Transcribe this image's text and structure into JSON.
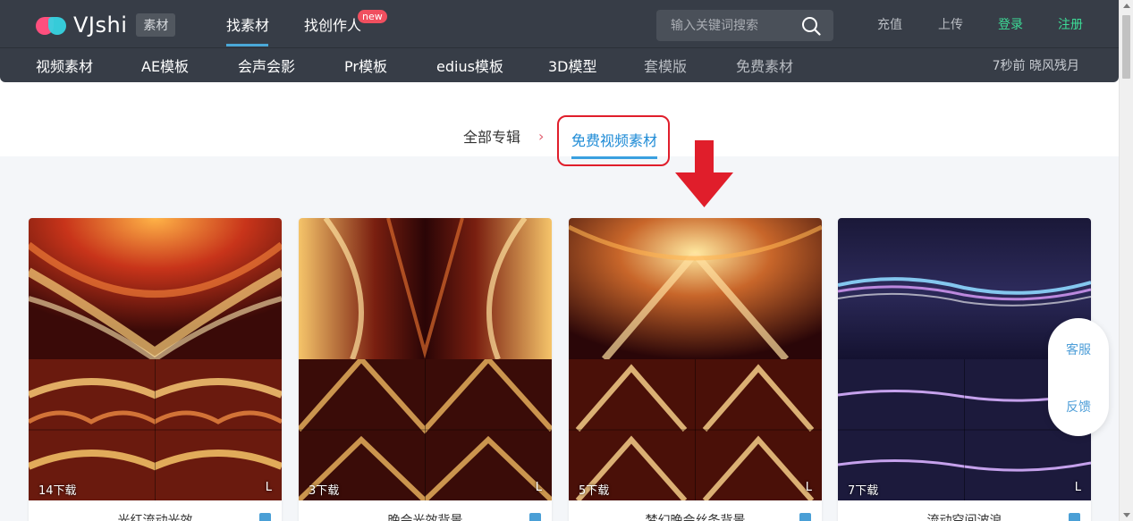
{
  "header": {
    "logo_text": "VJshi",
    "logo_tag": "素材",
    "nav": [
      {
        "label": "找素材"
      },
      {
        "label": "找创作人",
        "badge": "new"
      }
    ],
    "search": {
      "placeholder": "输入关键词搜索",
      "value": ""
    },
    "account": {
      "recharge": "充值",
      "upload": "上传",
      "login": "登录",
      "register": "注册"
    },
    "categories": [
      "视频素材",
      "AE模板",
      "会声会影",
      "Pr模板",
      "edius模板",
      "3D模型",
      "套模版",
      "免费素材"
    ],
    "recent_user": "7秒前 晓风残月"
  },
  "breadcrumb": {
    "all": "全部专辑",
    "separator": "›",
    "current": "免费视频素材"
  },
  "cards": [
    {
      "downloads": "14下载",
      "badge": "L",
      "title": "光红流动光效",
      "palette": "fire"
    },
    {
      "downloads": "3下载",
      "badge": "L",
      "title": "晚会光效背景",
      "palette": "ember"
    },
    {
      "downloads": "5下载",
      "badge": "L",
      "title": "梦幻晚会丝条背景",
      "palette": "gold"
    },
    {
      "downloads": "7下载",
      "badge": "L",
      "title": "流动空间波浪",
      "palette": "space"
    }
  ],
  "floating": {
    "service": "客服",
    "feedback": "反馈"
  },
  "colors": {
    "header_bg": "#373d47",
    "accent_blue": "#1e8bd6",
    "login_green": "#3ddc97",
    "highlight_red": "#e01e2b",
    "new_badge": "#f04f5f"
  }
}
